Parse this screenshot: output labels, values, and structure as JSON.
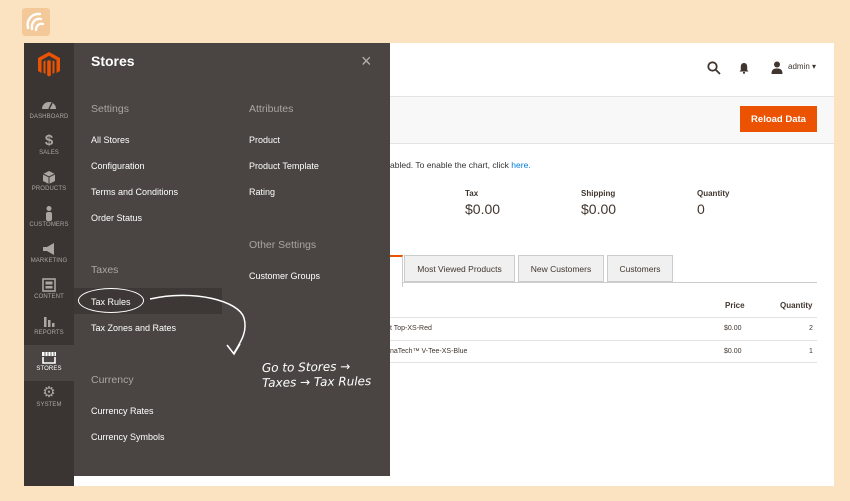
{
  "colors": {
    "accent": "#eb5202",
    "sidebar": "#3a3532",
    "panel": "#4a4542",
    "background": "#fbe3c2"
  },
  "brand_logo": "brand-monogram-icon",
  "sidebar": {
    "logo": "magento-logo-icon",
    "items": [
      {
        "label": "DASHBOARD",
        "icon": "dashboard-icon"
      },
      {
        "label": "SALES",
        "icon": "dollar-icon"
      },
      {
        "label": "PRODUCTS",
        "icon": "cube-icon"
      },
      {
        "label": "CUSTOMERS",
        "icon": "person-icon"
      },
      {
        "label": "MARKETING",
        "icon": "megaphone-icon"
      },
      {
        "label": "CONTENT",
        "icon": "content-icon"
      },
      {
        "label": "REPORTS",
        "icon": "bar-chart-icon"
      },
      {
        "label": "STORES",
        "icon": "store-icon"
      },
      {
        "label": "SYSTEM",
        "icon": "gear-icon"
      }
    ]
  },
  "stores_panel": {
    "title": "Stores",
    "close": "×",
    "settings": {
      "heading": "Settings",
      "links": [
        "All Stores",
        "Configuration",
        "Terms and Conditions",
        "Order Status"
      ]
    },
    "taxes": {
      "heading": "Taxes",
      "links": [
        "Tax Rules",
        "Tax Zones and Rates"
      ]
    },
    "currency": {
      "heading": "Currency",
      "links": [
        "Currency Rates",
        "Currency Symbols"
      ]
    },
    "attributes": {
      "heading": "Attributes",
      "links": [
        "Product",
        "Product Template",
        "Rating"
      ]
    },
    "other": {
      "heading": "Other Settings",
      "links": [
        "Customer Groups"
      ]
    }
  },
  "header": {
    "admin_label": "admin"
  },
  "actions": {
    "reload": "Reload Data"
  },
  "chart_note": {
    "text": "abled. To enable the chart, click ",
    "link": "here."
  },
  "stats": [
    {
      "label": "Tax",
      "value": "$0.00"
    },
    {
      "label": "Shipping",
      "value": "$0.00"
    },
    {
      "label": "Quantity",
      "value": "0"
    }
  ],
  "tabs": [
    "Most Viewed Products",
    "New Customers",
    "Customers"
  ],
  "table": {
    "headers": [
      "Price",
      "Quantity"
    ],
    "rows": [
      {
        "product": "t Top-XS-Red",
        "price": "$0.00",
        "quantity": "2"
      },
      {
        "product": "naTech™ V-Tee-XS-Blue",
        "price": "$0.00",
        "quantity": "1"
      }
    ]
  },
  "annotation": {
    "line1": "Go to Stores →",
    "line2": "Taxes → Tax Rules"
  }
}
